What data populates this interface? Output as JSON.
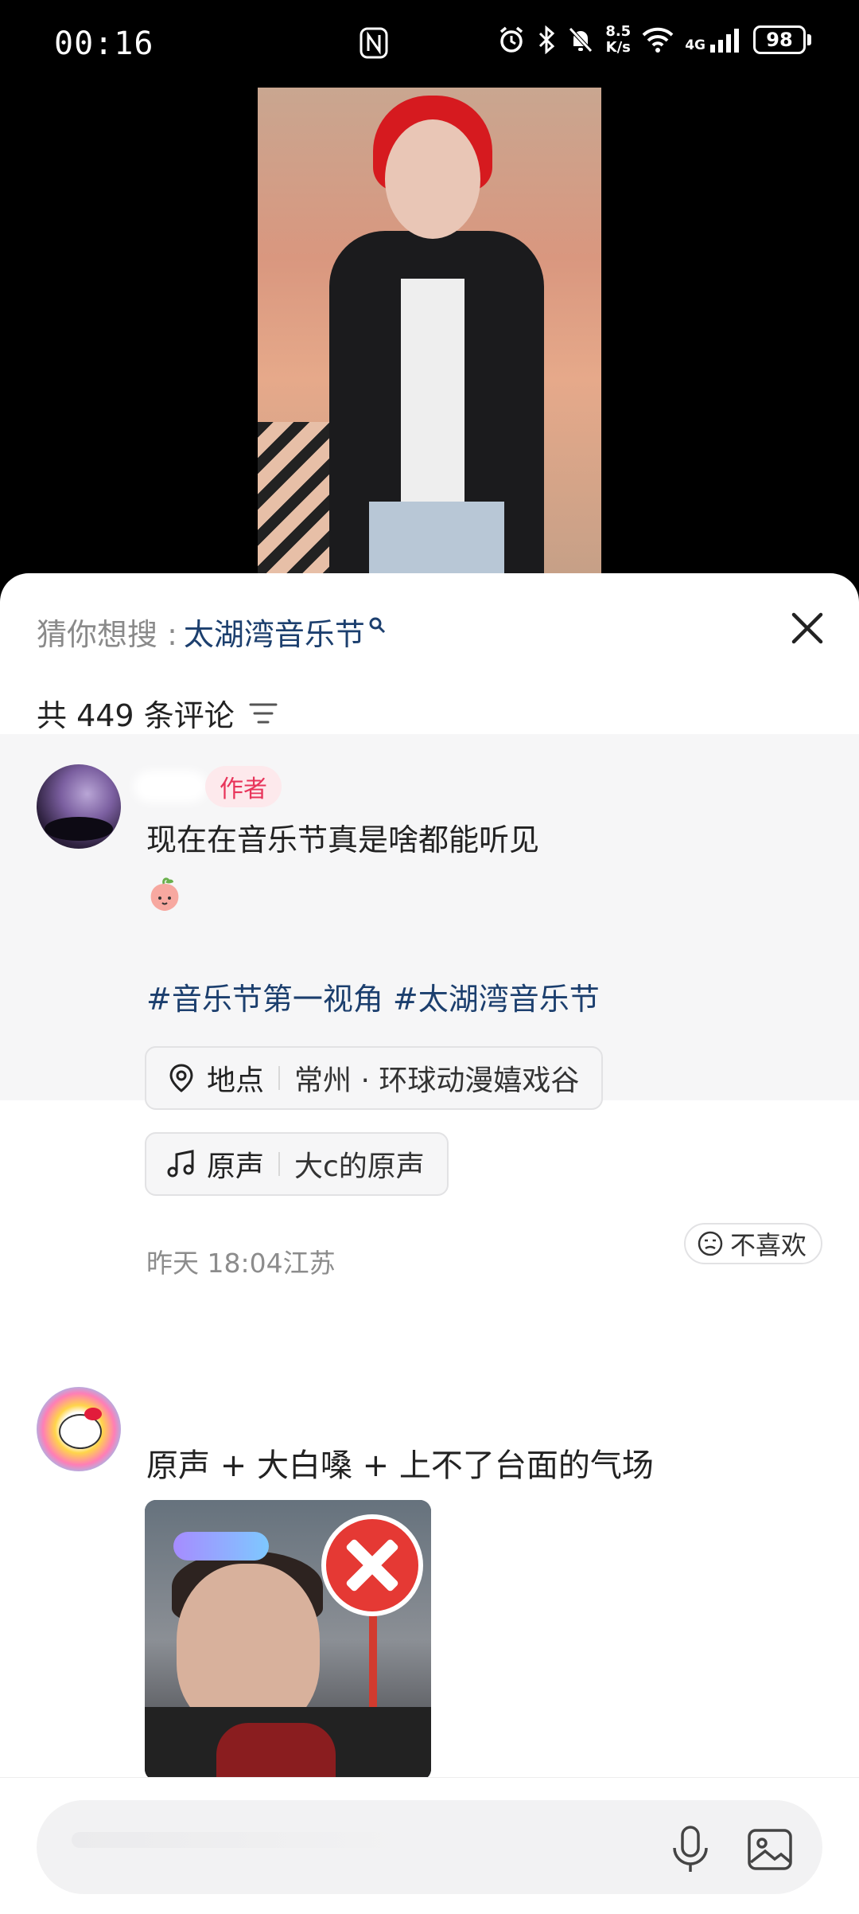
{
  "status_bar": {
    "time": "00:16",
    "net_speed_value": "8.5",
    "net_speed_unit": "K/s",
    "network": "4G",
    "battery": "98"
  },
  "sheet": {
    "suggest_prefix": "猜你想搜 : ",
    "suggest_keyword": "太湖湾音乐节",
    "comment_count": "共 449 条评论"
  },
  "author_comment": {
    "tag": "作者",
    "text": "现在在音乐节真是啥都能听见",
    "hashtags": "#音乐节第一视角 #太湖湾音乐节",
    "location_label": "地点",
    "location_value": "常州 · 环球动漫嬉戏谷",
    "sound_label": "原声",
    "sound_value": "大c的原声",
    "meta": "昨天 18:04江苏",
    "dislike": "不喜欢"
  },
  "comment2": {
    "text": "原声 + 大白嗓 + 上不了台面的气场"
  },
  "colors": {
    "hashtag": "#1c3f6e",
    "author_tag_bg": "#fde9ec",
    "author_tag_text": "#e8345a"
  }
}
